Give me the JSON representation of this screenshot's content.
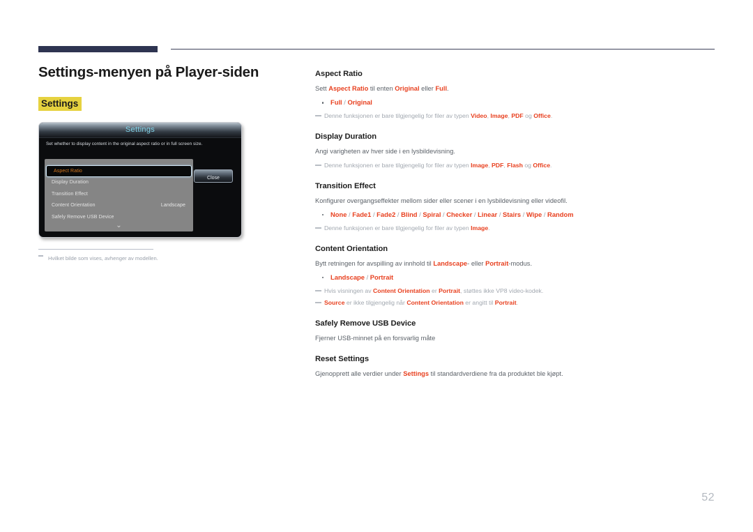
{
  "page": {
    "title": "Settings-menyen på Player-siden",
    "section_chip": "Settings",
    "page_number": "52"
  },
  "osd": {
    "title": "Settings",
    "description": "Set whether to display content in the original aspect ratio or in full screen size.",
    "close_label": "Close",
    "scroll_chevron": "⌄",
    "rows": [
      {
        "label": "Aspect Ratio",
        "value": "",
        "selected": true
      },
      {
        "label": "Display Duration",
        "value": "",
        "selected": false
      },
      {
        "label": "Transition Effect",
        "value": "",
        "selected": false
      },
      {
        "label": "Content Orientation",
        "value": "Landscape",
        "selected": false
      },
      {
        "label": "Safely Remove USB Device",
        "value": "",
        "selected": false
      }
    ]
  },
  "image_note": "Hvilket bilde som vises, avhenger av modellen.",
  "entries": [
    {
      "heading": "Aspect Ratio",
      "body_html": "Sett <b>Aspect Ratio</b> til enten <b>Original</b> eller <b>Full</b>.",
      "bullet_html": "Full <span class=\"sep\">/</span> Original",
      "notes_html": [
        "Denne funksjonen er bare tilgjengelig for filer av typen <b>Video</b>, <b>Image</b>, <b>PDF</b> og <b>Office</b>."
      ]
    },
    {
      "heading": "Display Duration",
      "body_html": "Angi varigheten av hver side i en lysbildevisning.",
      "bullet_html": "",
      "notes_html": [
        "Denne funksjonen er bare tilgjengelig for filer av typen <b>Image</b>, <b>PDF</b>, <b>Flash</b> og <b>Office</b>."
      ]
    },
    {
      "heading": "Transition Effect",
      "body_html": "Konfigurer overgangseffekter mellom sider eller scener i en lysbildevisning eller videofil.",
      "bullet_html": "None <span class=\"sep\">/</span> Fade1 <span class=\"sep\">/</span> Fade2 <span class=\"sep\">/</span> Blind <span class=\"sep\">/</span> Spiral <span class=\"sep\">/</span> Checker <span class=\"sep\">/</span> Linear <span class=\"sep\">/</span> Stairs <span class=\"sep\">/</span> Wipe <span class=\"sep\">/</span> Random",
      "notes_html": [
        "Denne funksjonen er bare tilgjengelig for filer av typen <b>Image</b>."
      ]
    },
    {
      "heading": "Content Orientation",
      "body_html": "Bytt retningen for avspilling av innhold til <b>Landscape</b>- eller <b>Portrait</b>-modus.",
      "bullet_html": "Landscape <span class=\"sep\">/</span> Portrait",
      "notes_html": [
        "Hvis visningen av <b>Content Orientation</b> er <b>Portrait</b>, støttes ikke VP8 video-kodek.",
        "<b>Source</b> er ikke tilgjengelig når <b>Content Orientation</b> er angitt til <b>Portrait</b>."
      ]
    },
    {
      "heading": "Safely Remove USB Device",
      "body_html": "Fjerner USB-minnet på en forsvarlig måte",
      "bullet_html": "",
      "notes_html": []
    },
    {
      "heading": "Reset Settings",
      "body_html": "Gjenopprett alle verdier under <b>Settings</b> til standardverdiene fra da produktet ble kjøpt.",
      "bullet_html": "",
      "notes_html": []
    }
  ],
  "colors": {
    "accent_red": "#e8401f",
    "highlight_yellow": "#e6d23f",
    "header_navy": "#2e3451",
    "body_gray": "#5b6168",
    "note_gray": "#a2a8b0",
    "osd_title_cyan": "#7fd3e8",
    "osd_selected_orange": "#d8781f"
  }
}
